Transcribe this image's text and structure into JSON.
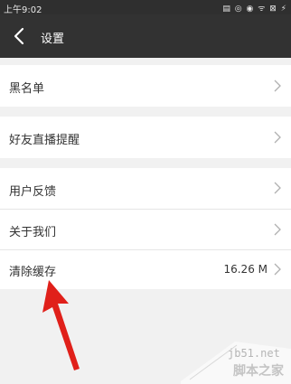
{
  "status_bar": {
    "time": "上午9:02",
    "icons_text": "▤ ◎ ◉ ᯤ ⊠ ⚡"
  },
  "app_bar": {
    "title": "设置"
  },
  "settings": {
    "blacklist": "黑名单",
    "friend_live_reminder": "好友直播提醒",
    "feedback": "用户反馈",
    "about_us": "关于我们",
    "clear_cache": "清除缓存",
    "cache_size": "16.26 M"
  },
  "watermark": {
    "url": "jb51.net",
    "text": "脚本之家"
  },
  "colors": {
    "bar": "#323232",
    "background": "#f1f1f1",
    "row": "#ffffff",
    "arrow": "#e0201a"
  }
}
